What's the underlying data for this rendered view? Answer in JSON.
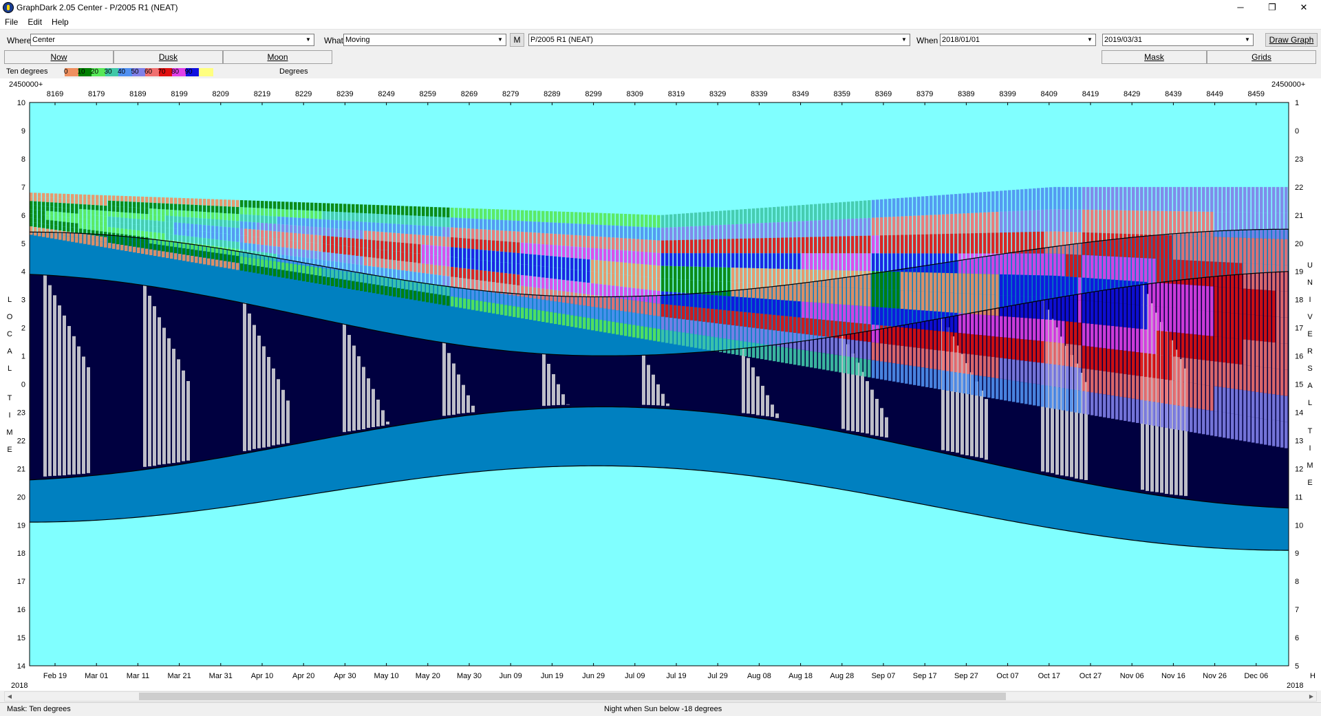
{
  "window": {
    "title": "GraphDark 2.05  Center  -  P/2005 R1 (NEAT)",
    "minimize": "─",
    "maximize": "❐",
    "close": "✕"
  },
  "menu": [
    "File",
    "Edit",
    "Help"
  ],
  "toolbar": {
    "where_label": "Where",
    "where_value": "Center",
    "what_label": "What",
    "what_value": "Moving",
    "m_button": "M",
    "object_value": "P/2005 R1 (NEAT)",
    "when_label": "When",
    "start_date": "2018/01/01",
    "end_date": "2019/03/31",
    "draw_button": "Draw Graph"
  },
  "tabs": {
    "now": "Now",
    "dusk": "Dusk",
    "moon": "Moon",
    "mask": "Mask",
    "grids": "Grids"
  },
  "legend": {
    "title": "Ten degrees",
    "unit": "Degrees",
    "colors": [
      {
        "label": "0",
        "color": "#ef9060"
      },
      {
        "label": "10",
        "color": "#008000"
      },
      {
        "label": "20",
        "color": "#58e858"
      },
      {
        "label": "30",
        "color": "#40c8a8"
      },
      {
        "label": "40",
        "color": "#5090f0"
      },
      {
        "label": "50",
        "color": "#8080e8"
      },
      {
        "label": "60",
        "color": "#f07070"
      },
      {
        "label": "70",
        "color": "#e01010"
      },
      {
        "label": "80",
        "color": "#e040e8"
      },
      {
        "label": "90",
        "color": "#1010e0"
      },
      {
        "label": "",
        "color": "#ffff80"
      }
    ]
  },
  "chart_data": {
    "type": "heatmap",
    "jd_prefix": "2450000+",
    "top_ticks": [
      "8169",
      "8179",
      "8189",
      "8199",
      "8209",
      "8219",
      "8229",
      "8239",
      "8249",
      "8259",
      "8269",
      "8279",
      "8289",
      "8299",
      "8309",
      "8319",
      "8329",
      "8339",
      "8349",
      "8359",
      "8369",
      "8379",
      "8389",
      "8399",
      "8409",
      "8419",
      "8429",
      "8439",
      "8449",
      "8459"
    ],
    "date_ticks": [
      "Feb 19",
      "Mar 01",
      "Mar 11",
      "Mar 21",
      "Mar 31",
      "Apr 10",
      "Apr 20",
      "Apr 30",
      "May 10",
      "May 20",
      "May 30",
      "Jun 09",
      "Jun 19",
      "Jun 29",
      "Jul 09",
      "Jul 19",
      "Jul 29",
      "Aug 08",
      "Aug 18",
      "Aug 28",
      "Sep 07",
      "Sep 17",
      "Sep 27",
      "Oct 07",
      "Oct 17",
      "Oct 27",
      "Nov 06",
      "Nov 16",
      "Nov 26",
      "Dec 06"
    ],
    "year_left": "2018",
    "year_right": "2018",
    "y_left_ticks": [
      "10",
      "9",
      "8",
      "7",
      "6",
      "5",
      "4",
      "3",
      "2",
      "1",
      "0",
      "23",
      "22",
      "21",
      "20",
      "19",
      "18",
      "17",
      "16",
      "15",
      "14"
    ],
    "y_right_ticks": [
      "1",
      "0",
      "23",
      "22",
      "21",
      "20",
      "19",
      "18",
      "17",
      "16",
      "15",
      "14",
      "13",
      "12",
      "11",
      "10",
      "9",
      "8",
      "7",
      "6",
      "5"
    ],
    "y_left_label": "LOCAL TIME",
    "y_right_label": "UNIVERSAL TIME",
    "right_edge_marker": "H",
    "sunset_hours_local": {
      "start": 19.1,
      "mid": 21.1,
      "end": 18.1
    },
    "sunrise_hours_local": {
      "start": 5.4,
      "mid": 3.1,
      "end": 5.5
    },
    "colors": {
      "day": "#80ffff",
      "twilight": "#0080c0",
      "dark": "#000040",
      "moon": "#c8c8d0"
    }
  },
  "status": {
    "mask": "Mask:  Ten degrees",
    "night": "Night when Sun below -18 degrees"
  }
}
